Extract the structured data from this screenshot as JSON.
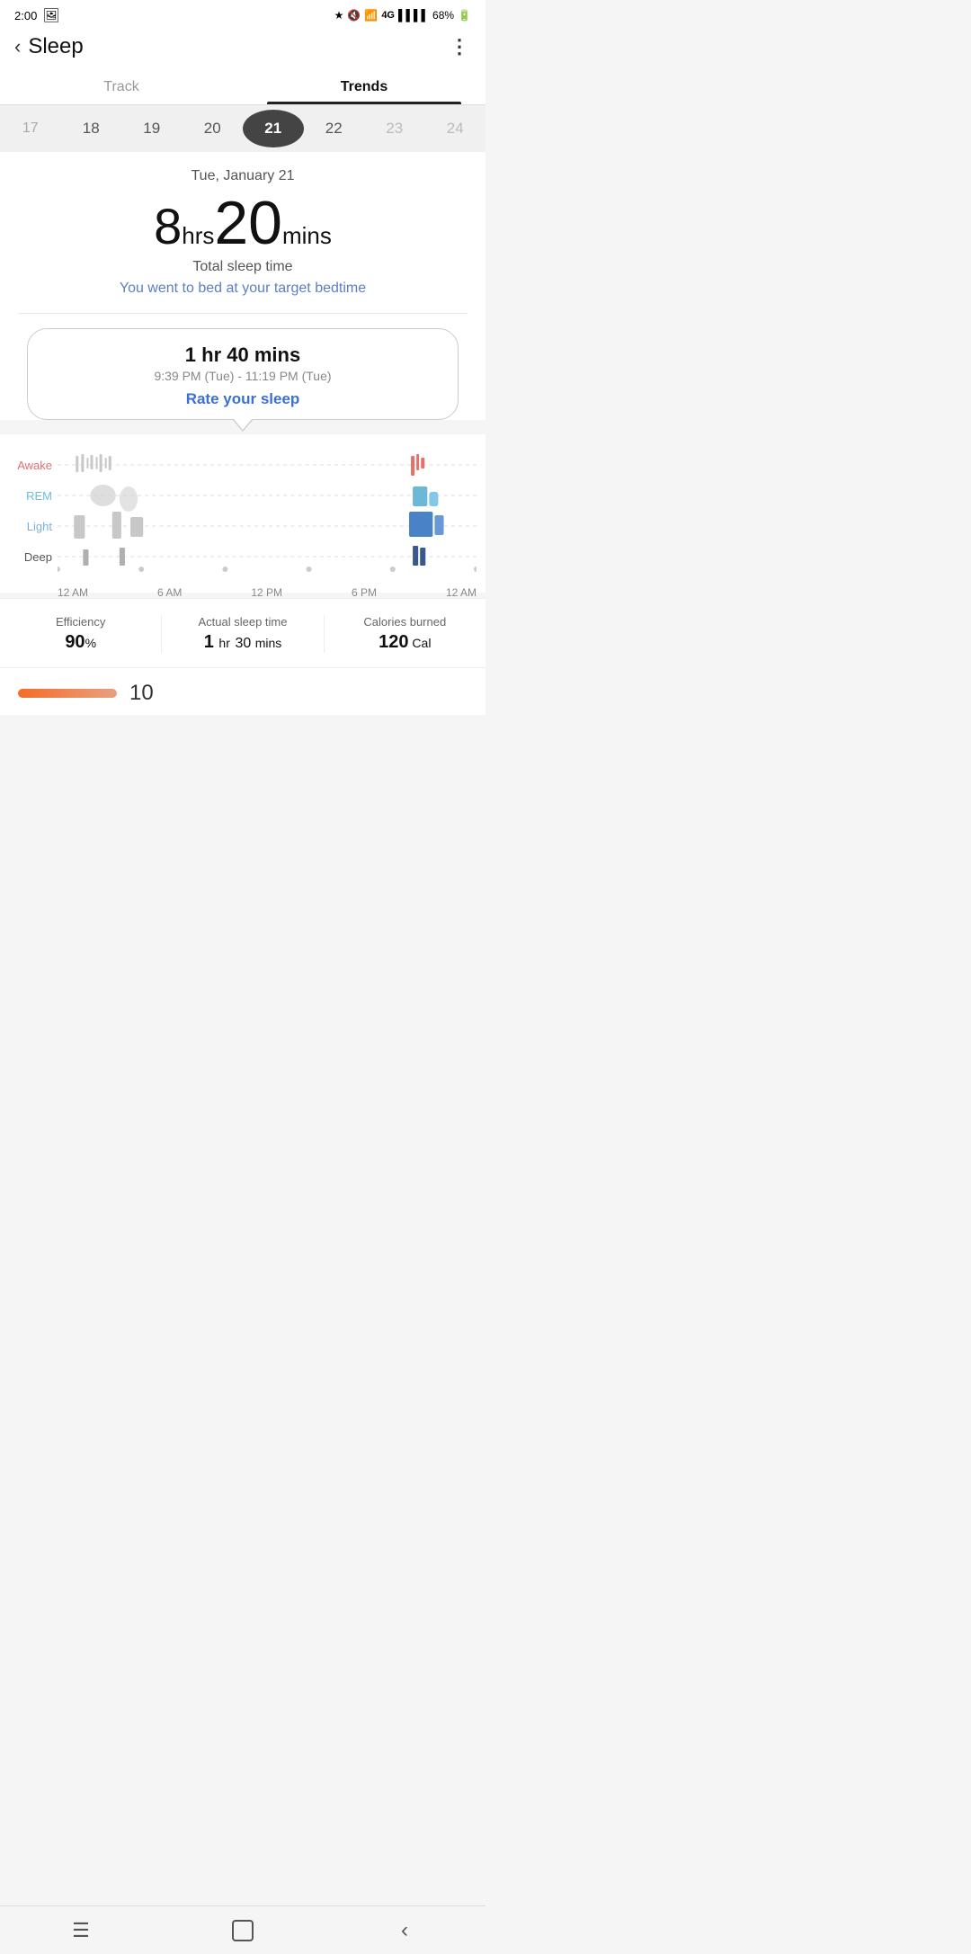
{
  "statusBar": {
    "time": "2:00",
    "battery": "68%",
    "signal": "4G"
  },
  "topBar": {
    "title": "Sleep",
    "backLabel": "‹",
    "moreLabel": "⋮"
  },
  "tabs": [
    {
      "id": "track",
      "label": "Track",
      "active": false
    },
    {
      "id": "trends",
      "label": "Trends",
      "active": true
    }
  ],
  "dateStrip": {
    "dates": [
      {
        "value": "17",
        "selected": false,
        "faded": false
      },
      {
        "value": "18",
        "selected": false,
        "faded": false
      },
      {
        "value": "19",
        "selected": false,
        "faded": false
      },
      {
        "value": "20",
        "selected": false,
        "faded": false
      },
      {
        "value": "21",
        "selected": true,
        "faded": false
      },
      {
        "value": "22",
        "selected": false,
        "faded": false
      },
      {
        "value": "23",
        "selected": false,
        "faded": true
      },
      {
        "value": "24",
        "selected": false,
        "faded": true
      }
    ]
  },
  "sleepSummary": {
    "dateLabel": "Tue, January 21",
    "hours": "8",
    "hrsUnit": "hrs",
    "mins": "20",
    "minsUnit": "mins",
    "totalLabel": "Total sleep time",
    "targetMessage": "You went to bed at your target bedtime"
  },
  "sessionCard": {
    "duration": "1 hr 40 mins",
    "timeRange": "9:39 PM (Tue) - 11:19 PM (Tue)",
    "rateLabel": "Rate your sleep"
  },
  "sleepChart": {
    "yLabels": [
      {
        "label": "Awake",
        "class": "awake"
      },
      {
        "label": "REM",
        "class": "rem"
      },
      {
        "label": "Light",
        "class": "light"
      },
      {
        "label": "Deep",
        "class": "deep"
      }
    ],
    "xLabels": [
      "12 AM",
      "6 AM",
      "12 PM",
      "6 PM",
      "12 AM"
    ]
  },
  "stats": [
    {
      "name": "Efficiency",
      "value": "90",
      "unit": "%",
      "extra": ""
    },
    {
      "name": "Actual sleep time",
      "value": "1 hr",
      "unit": "",
      "extra": "30 mins"
    },
    {
      "name": "Calories burned",
      "value": "120",
      "unit": "Cal",
      "extra": ""
    }
  ],
  "bottomSection": {
    "partialNumber": "10"
  },
  "bottomNav": {
    "menuIcon": "☰",
    "homeIcon": "⬜",
    "backIcon": "‹"
  }
}
